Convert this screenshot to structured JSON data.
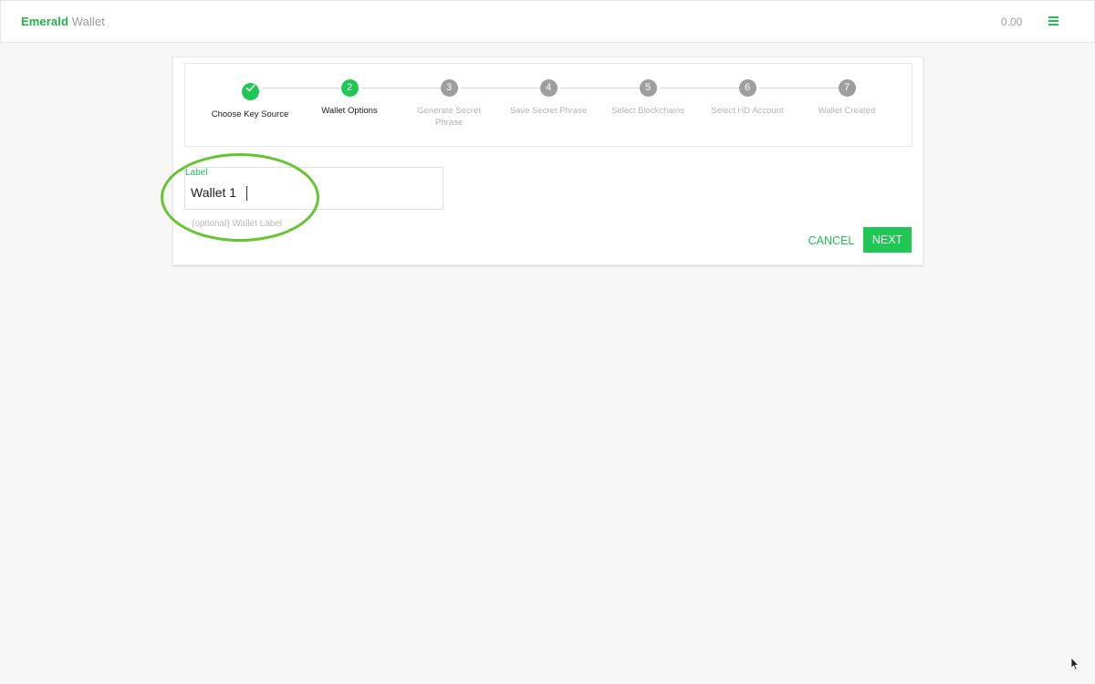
{
  "app": {
    "brand_primary": "Emerald",
    "brand_secondary": "Wallet",
    "balance": "0.00",
    "menu_icon": "hamburger-menu-icon"
  },
  "colors": {
    "accent": "#1fc854",
    "inactive_step": "#9e9e9e",
    "highlight_ring": "#66c52f",
    "background": "#f6f7f6"
  },
  "stepper": {
    "steps": [
      {
        "number": "1",
        "label": "Choose Key Source",
        "state": "completed",
        "icon": "check-icon"
      },
      {
        "number": "2",
        "label": "Wallet Options",
        "state": "active"
      },
      {
        "number": "3",
        "label": "Generate Secret Phrase",
        "state": "pending"
      },
      {
        "number": "4",
        "label": "Save Secret Phrase",
        "state": "pending"
      },
      {
        "number": "5",
        "label": "Select Blockchains",
        "state": "pending"
      },
      {
        "number": "6",
        "label": "Select HD Account",
        "state": "pending"
      },
      {
        "number": "7",
        "label": "Wallet Created",
        "state": "pending"
      }
    ]
  },
  "form": {
    "label": "Label",
    "value": "Wallet 1",
    "helper": "(optional) Wallet Label"
  },
  "actions": {
    "cancel": "CANCEL",
    "next": "NEXT"
  }
}
